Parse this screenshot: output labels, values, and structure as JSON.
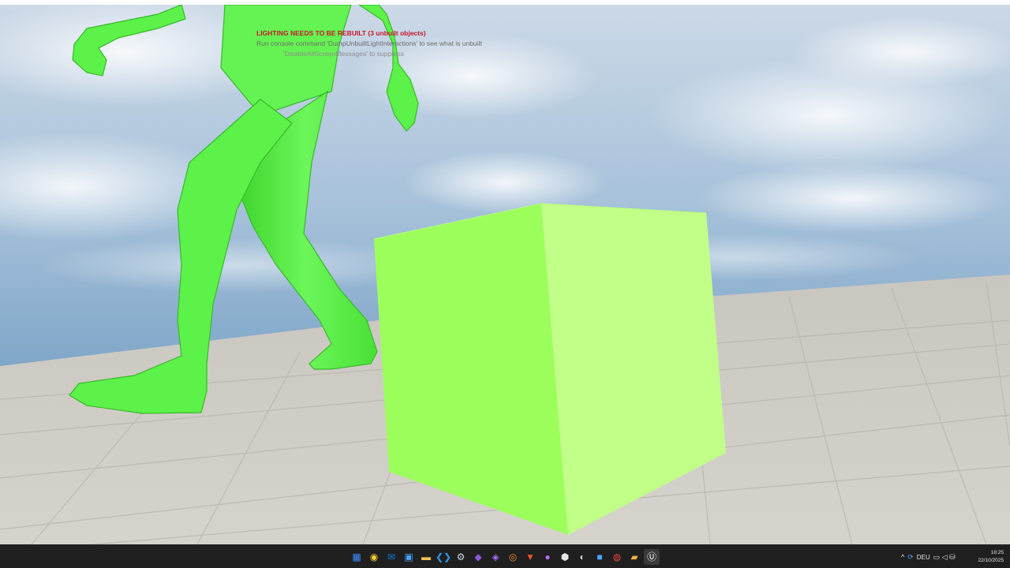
{
  "screen_messages": {
    "warning": "LIGHTING NEEDS TO BE REBUILT (3 unbuilt objects)",
    "info": "Run console command 'DumpUnbuiltLightInteractions' to see what is unbuilt",
    "suppress": "'DisableAllScreenMessages' to suppress"
  },
  "colors": {
    "warning_text": "#c8182a",
    "character": "#5cf24a",
    "cube_front": "#9cff5c",
    "cube_side": "#c2ff88",
    "floor": "#d0cdc6",
    "sky_top": "#c8d7e6",
    "sky_horizon": "#7fa6c8"
  },
  "taskbar": {
    "apps": [
      {
        "icon": "windows-start-icon",
        "glyph": "▦"
      },
      {
        "icon": "chrome-icon",
        "glyph": "◉"
      },
      {
        "icon": "outlook-icon",
        "glyph": "✉"
      },
      {
        "icon": "photos-icon",
        "glyph": "▣"
      },
      {
        "icon": "file-explorer-icon",
        "glyph": "▬"
      },
      {
        "icon": "vscode-icon",
        "glyph": "❮❯"
      },
      {
        "icon": "steam-icon",
        "glyph": "⚙"
      },
      {
        "icon": "visual-studio-icon",
        "glyph": "◆"
      },
      {
        "icon": "visual-studio-purple-icon",
        "glyph": "◈"
      },
      {
        "icon": "blender-icon",
        "glyph": "◎"
      },
      {
        "icon": "brave-icon",
        "glyph": "▼"
      },
      {
        "icon": "app-purple-icon",
        "glyph": "●"
      },
      {
        "icon": "tool-icon",
        "glyph": "⬢"
      },
      {
        "icon": "obs-icon",
        "glyph": "◐"
      },
      {
        "icon": "photoshop-icon",
        "glyph": "■"
      },
      {
        "icon": "record-icon",
        "glyph": "◍"
      },
      {
        "icon": "archive-icon",
        "glyph": "▰"
      },
      {
        "icon": "unreal-engine-icon",
        "glyph": "Ⓤ"
      }
    ],
    "tray": {
      "chevron": "^",
      "sync": "⟳",
      "language": "DEU",
      "status_icons": "▭ ◁ ⛁"
    },
    "clock": {
      "time": "18:25",
      "date": "22/10/2025"
    }
  }
}
